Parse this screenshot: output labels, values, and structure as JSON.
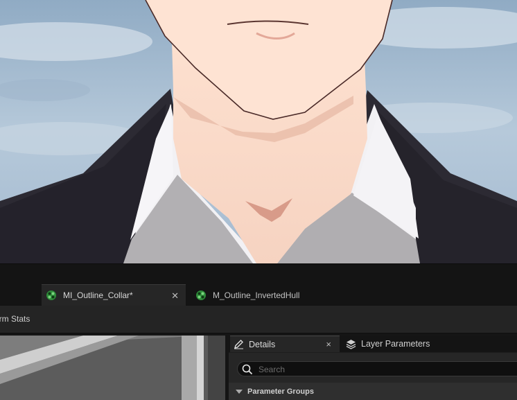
{
  "document_tabs": [
    {
      "label": "MI_Outline_Collar*",
      "icon": "material-instance-icon",
      "active": true,
      "closable": true
    },
    {
      "label": "M_Outline_InvertedHull",
      "icon": "material-icon",
      "active": false,
      "closable": false
    }
  ],
  "toolbar": {
    "stats_label": "orm Stats"
  },
  "details_panel": {
    "tabs": [
      {
        "label": "Details",
        "icon": "pencil-icon",
        "close_glyph": "×"
      },
      {
        "label": "Layer Parameters",
        "icon": "layers-icon"
      }
    ],
    "search": {
      "placeholder": "Search",
      "value": ""
    },
    "section": {
      "label": "Parameter Groups",
      "icon": "triangle-down-icon"
    }
  },
  "colors": {
    "accent_green": "#3fae49",
    "panel_bg": "#262626",
    "tab_bar_bg": "#141414"
  }
}
